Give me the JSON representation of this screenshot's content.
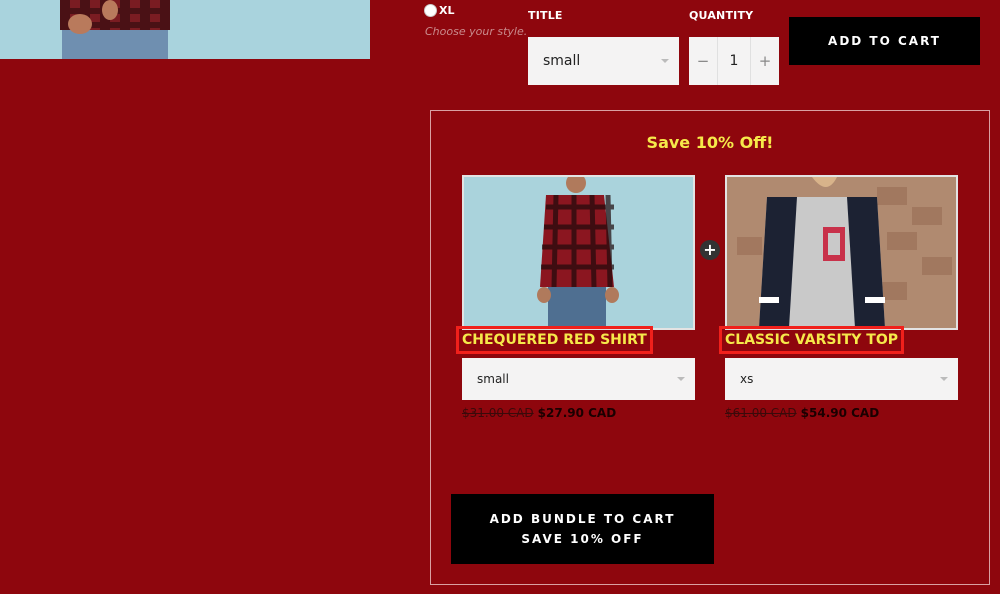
{
  "product_options": {
    "size_option": "XL",
    "hint": "Choose your style.",
    "title_label": "TITLE",
    "title_value": "small",
    "quantity_label": "QUANTITY",
    "quantity_value": "1",
    "decrement": "−",
    "increment": "+",
    "add_to_cart": "ADD TO CART"
  },
  "bundle": {
    "heading": "Save 10% Off!",
    "plus": "+",
    "products": [
      {
        "name": "CHEQUERED RED SHIRT",
        "variant": "small",
        "old_price": "$31.00 CAD",
        "new_price": "$27.90 CAD"
      },
      {
        "name": "CLASSIC VARSITY TOP",
        "variant": "xs",
        "old_price": "$61.00 CAD",
        "new_price": "$54.90 CAD"
      }
    ],
    "button_line1": "ADD BUNDLE TO CART",
    "button_line2": "SAVE 10% OFF"
  },
  "colors": {
    "background": "#8e060d",
    "accent_yellow": "#f6e94a",
    "highlight_red": "#f1201b"
  }
}
